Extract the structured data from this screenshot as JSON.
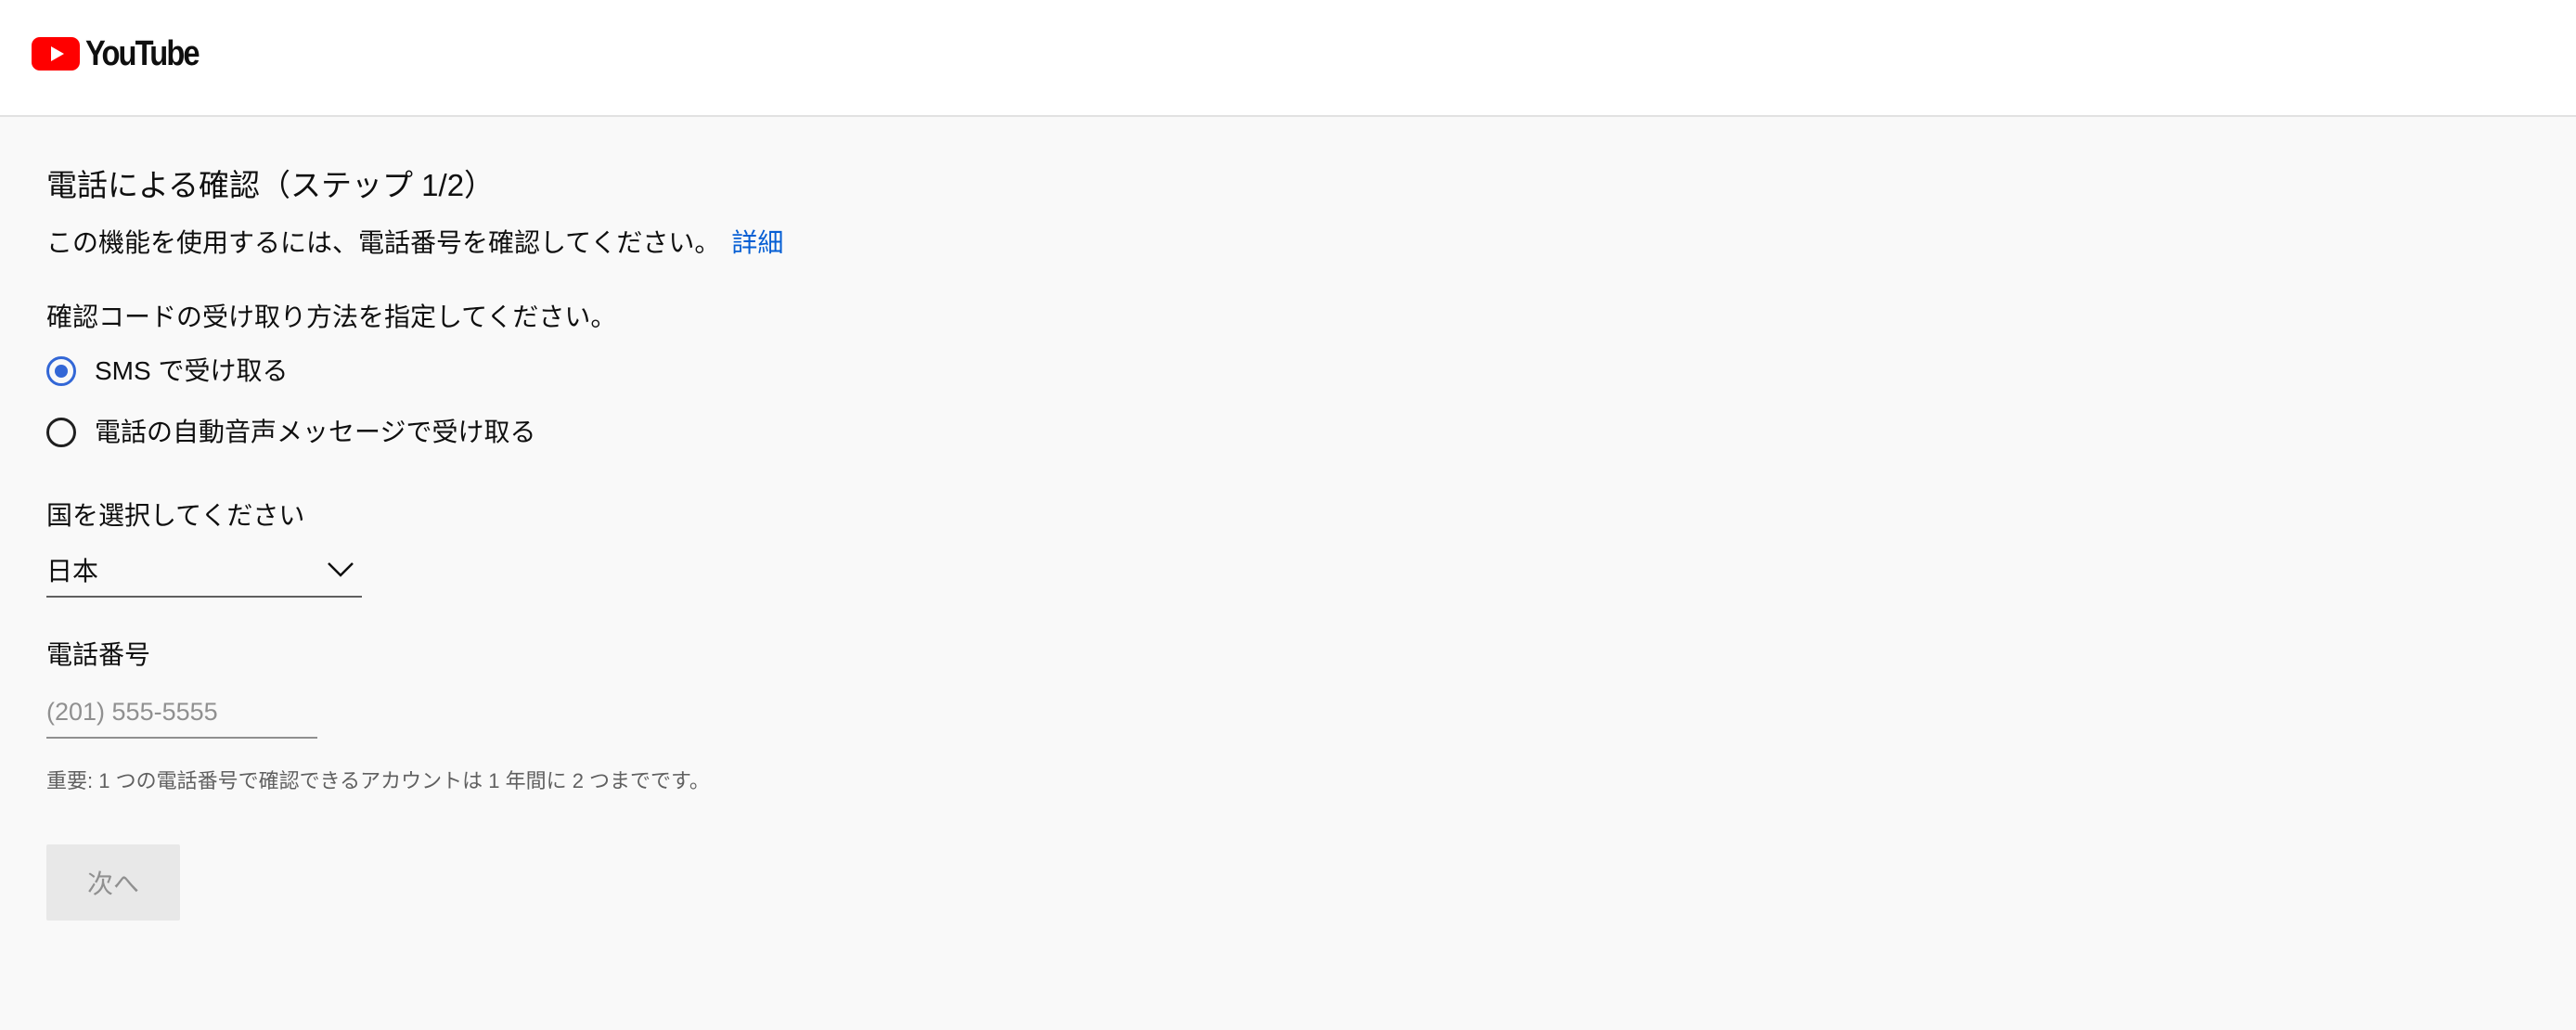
{
  "header": {
    "logo_text": "YouTube",
    "logo_icon": "youtube-play-icon",
    "brand_color": "#ff0000"
  },
  "verification": {
    "title": "電話による確認（ステップ 1/2）",
    "description": "この機能を使用するには、電話番号を確認してください。",
    "learn_more_link": "詳細",
    "method_label": "確認コードの受け取り方法を指定してください。",
    "methods": [
      {
        "label": "SMS で受け取る",
        "selected": true
      },
      {
        "label": "電話の自動音声メッセージで受け取る",
        "selected": false
      }
    ],
    "country_label": "国を選択してください",
    "country_value": "日本",
    "phone_label": "電話番号",
    "phone_placeholder": "(201) 555-5555",
    "phone_value": "",
    "note": "重要: 1 つの電話番号で確認できるアカウントは 1 年間に 2 つまでです。",
    "next_button": "次へ",
    "next_enabled": false
  },
  "colors": {
    "accent": "#3367d6",
    "link": "#065fd4",
    "page_background": "#f9f9f9",
    "disabled_button_bg": "#e8e8e8",
    "disabled_button_text": "#909090"
  }
}
